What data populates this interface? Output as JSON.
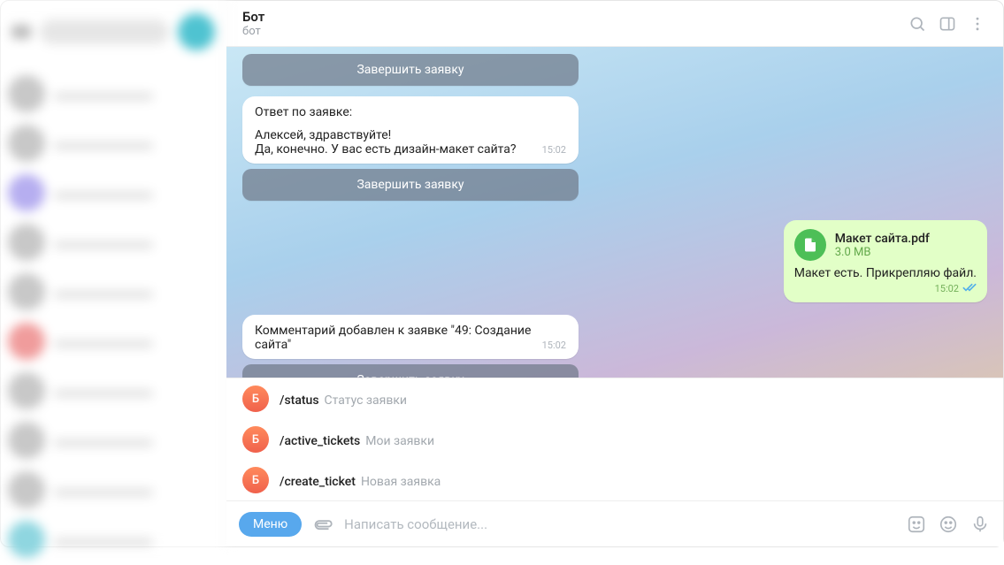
{
  "header": {
    "title": "Бот",
    "subtitle": "бот"
  },
  "messages": {
    "kb_label": "Завершить заявку",
    "reply1_header": "Ответ по заявке:",
    "reply1_line1": "Алексей, здравствуйте!",
    "reply1_line2": "Да, конечно. У вас есть дизайн-макет сайта?",
    "reply1_time": "15:02",
    "out_file_name": "Макет сайта.pdf",
    "out_file_size": "3.0 MB",
    "out_text": "Макет есть. Прикрепляю файл.",
    "out_time": "15:02",
    "comment_text": "Комментарий добавлен к заявке \"49: Создание сайта\"",
    "comment_time": "15:02",
    "reply2_header": "Ответ по заявке:"
  },
  "commands": {
    "avatar_letter": "Б",
    "items": [
      {
        "cmd": "/status",
        "desc": "Статус заявки"
      },
      {
        "cmd": "/active_tickets",
        "desc": "Мои заявки"
      },
      {
        "cmd": "/create_ticket",
        "desc": "Новая заявка"
      }
    ]
  },
  "input": {
    "menu_label": "Меню",
    "placeholder": "Написать сообщение..."
  }
}
